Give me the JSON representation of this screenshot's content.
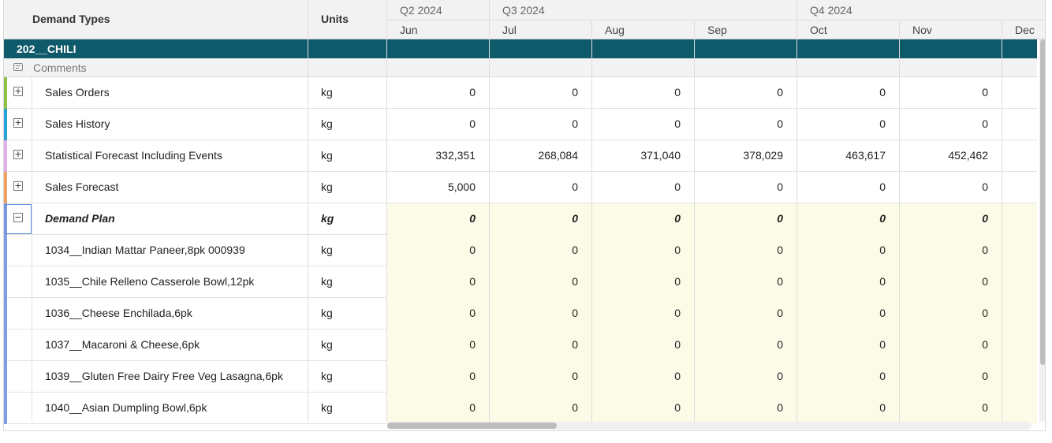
{
  "header": {
    "demand_types": "Demand Types",
    "units": "Units",
    "quarters": [
      "Q2 2024",
      "Q3 2024",
      "Q4 2024"
    ],
    "months": [
      "Jun",
      "Jul",
      "Aug",
      "Sep",
      "Oct",
      "Nov",
      "Dec"
    ]
  },
  "group": {
    "name": "202__CHILI"
  },
  "comments": {
    "label": "Comments",
    "icon": "comment-icon"
  },
  "rows": [
    {
      "label": "Sales Orders",
      "unit": "kg",
      "values": [
        "0",
        "0",
        "0",
        "0",
        "0",
        "0"
      ],
      "toggle": "+",
      "stripe": "#8bc34a"
    },
    {
      "label": "Sales History",
      "unit": "kg",
      "values": [
        "0",
        "0",
        "0",
        "0",
        "0",
        "0"
      ],
      "toggle": "+",
      "stripe": "#29a3d6"
    },
    {
      "label": "Statistical Forecast Including Events",
      "unit": "kg",
      "values": [
        "332,351",
        "268,084",
        "371,040",
        "378,029",
        "463,617",
        "452,462"
      ],
      "toggle": "+",
      "stripe": "#e0b0e8"
    },
    {
      "label": "Sales Forecast",
      "unit": "kg",
      "values": [
        "5,000",
        "0",
        "0",
        "0",
        "0",
        "0"
      ],
      "toggle": "+",
      "stripe": "#f0a060"
    },
    {
      "label": "Demand Plan",
      "unit": "kg",
      "values": [
        "0",
        "0",
        "0",
        "0",
        "0",
        "0"
      ],
      "toggle": "−",
      "stripe": "#7f9ee8"
    },
    {
      "label": "1034__Indian Mattar Paneer,8pk 000939",
      "unit": "kg",
      "values": [
        "0",
        "0",
        "0",
        "0",
        "0",
        "0"
      ]
    },
    {
      "label": "1035__Chile Relleno Casserole Bowl,12pk",
      "unit": "kg",
      "values": [
        "0",
        "0",
        "0",
        "0",
        "0",
        "0"
      ]
    },
    {
      "label": "1036__Cheese Enchilada,6pk",
      "unit": "kg",
      "values": [
        "0",
        "0",
        "0",
        "0",
        "0",
        "0"
      ]
    },
    {
      "label": "1037__Macaroni & Cheese,6pk",
      "unit": "kg",
      "values": [
        "0",
        "0",
        "0",
        "0",
        "0",
        "0"
      ]
    },
    {
      "label": "1039__Gluten Free Dairy Free Veg Lasagna,6pk",
      "unit": "kg",
      "values": [
        "0",
        "0",
        "0",
        "0",
        "0",
        "0"
      ]
    },
    {
      "label": "1040__Asian Dumpling Bowl,6pk",
      "unit": "kg",
      "values": [
        "0",
        "0",
        "0",
        "0",
        "0",
        "0"
      ]
    }
  ],
  "colors": {
    "group_band": "#0f5a6a",
    "demand_plan_highlight": "#fcfbe8",
    "header_bg": "#f2f2f2"
  }
}
